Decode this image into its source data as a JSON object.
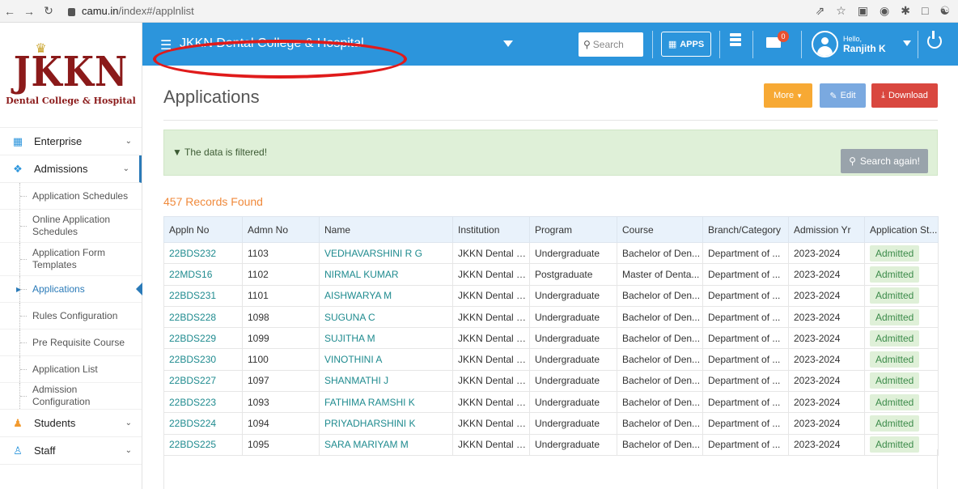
{
  "browser": {
    "url_host": "camu.in",
    "url_path": "/index#/applnlist"
  },
  "colors": {
    "accent": "#2c95dc",
    "link": "#1f8b8f",
    "brand": "#8b1a1a",
    "highlight": "#e01b1b"
  },
  "logo": {
    "mark": "JKKN",
    "sub": "Dental College & Hospital"
  },
  "sidebar": {
    "groups": [
      {
        "label": "Enterprise",
        "icon": "building-icon"
      },
      {
        "label": "Admissions",
        "icon": "diamond-icon"
      }
    ],
    "admission_items": [
      "Application Schedules",
      "Online Application Schedules",
      "Application Form Templates",
      "Applications",
      "Rules Configuration",
      "Pre Requisite Course",
      "Application List",
      "Admission Configuration"
    ],
    "lower_groups": [
      {
        "label": "Students",
        "icon": "students-icon"
      },
      {
        "label": "Staff",
        "icon": "staff-icon"
      }
    ]
  },
  "header": {
    "org_name": "JKKN Dental College & Hospital",
    "search_placeholder": "Search",
    "apps_label": "APPS",
    "mail_count": "0",
    "hello": "Hello,",
    "user_name": "Ranjith K"
  },
  "page": {
    "title": "Applications",
    "more_label": "More",
    "edit_label": "Edit",
    "download_label": "Download",
    "filter_msg": "The data is filtered!",
    "search_again_label": "Search again!",
    "records_count": "457",
    "records_label": " Records Found"
  },
  "table": {
    "columns": [
      "Appln No",
      "Admn No",
      "Name",
      "Institution",
      "Program",
      "Course",
      "Branch/Category",
      "Admission Yr",
      "Application St..."
    ],
    "rows": [
      [
        "22BDS232",
        "1103",
        "VEDHAVARSHINI R G",
        "JKKN Dental C...",
        "Undergraduate",
        "Bachelor of Den...",
        "Department of ...",
        "2023-2024",
        "Admitted"
      ],
      [
        "22MDS16",
        "1102",
        "NIRMAL KUMAR",
        "JKKN Dental C...",
        "Postgraduate",
        "Master of Denta...",
        "Department of ...",
        "2023-2024",
        "Admitted"
      ],
      [
        "22BDS231",
        "1101",
        "AISHWARYA M",
        "JKKN Dental C...",
        "Undergraduate",
        "Bachelor of Den...",
        "Department of ...",
        "2023-2024",
        "Admitted"
      ],
      [
        "22BDS228",
        "1098",
        "SUGUNA C",
        "JKKN Dental C...",
        "Undergraduate",
        "Bachelor of Den...",
        "Department of ...",
        "2023-2024",
        "Admitted"
      ],
      [
        "22BDS229",
        "1099",
        "SUJITHA M",
        "JKKN Dental C...",
        "Undergraduate",
        "Bachelor of Den...",
        "Department of ...",
        "2023-2024",
        "Admitted"
      ],
      [
        "22BDS230",
        "1100",
        "VINOTHINI A",
        "JKKN Dental C...",
        "Undergraduate",
        "Bachelor of Den...",
        "Department of ...",
        "2023-2024",
        "Admitted"
      ],
      [
        "22BDS227",
        "1097",
        "SHANMATHI J",
        "JKKN Dental C...",
        "Undergraduate",
        "Bachelor of Den...",
        "Department of ...",
        "2023-2024",
        "Admitted"
      ],
      [
        "22BDS223",
        "1093",
        "FATHIMA RAMSHI K",
        "JKKN Dental C...",
        "Undergraduate",
        "Bachelor of Den...",
        "Department of ...",
        "2023-2024",
        "Admitted"
      ],
      [
        "22BDS224",
        "1094",
        "PRIYADHARSHINI K",
        "JKKN Dental C...",
        "Undergraduate",
        "Bachelor of Den...",
        "Department of ...",
        "2023-2024",
        "Admitted"
      ],
      [
        "22BDS225",
        "1095",
        "SARA MARIYAM M",
        "JKKN Dental C...",
        "Undergraduate",
        "Bachelor of Den...",
        "Department of ...",
        "2023-2024",
        "Admitted"
      ]
    ]
  }
}
